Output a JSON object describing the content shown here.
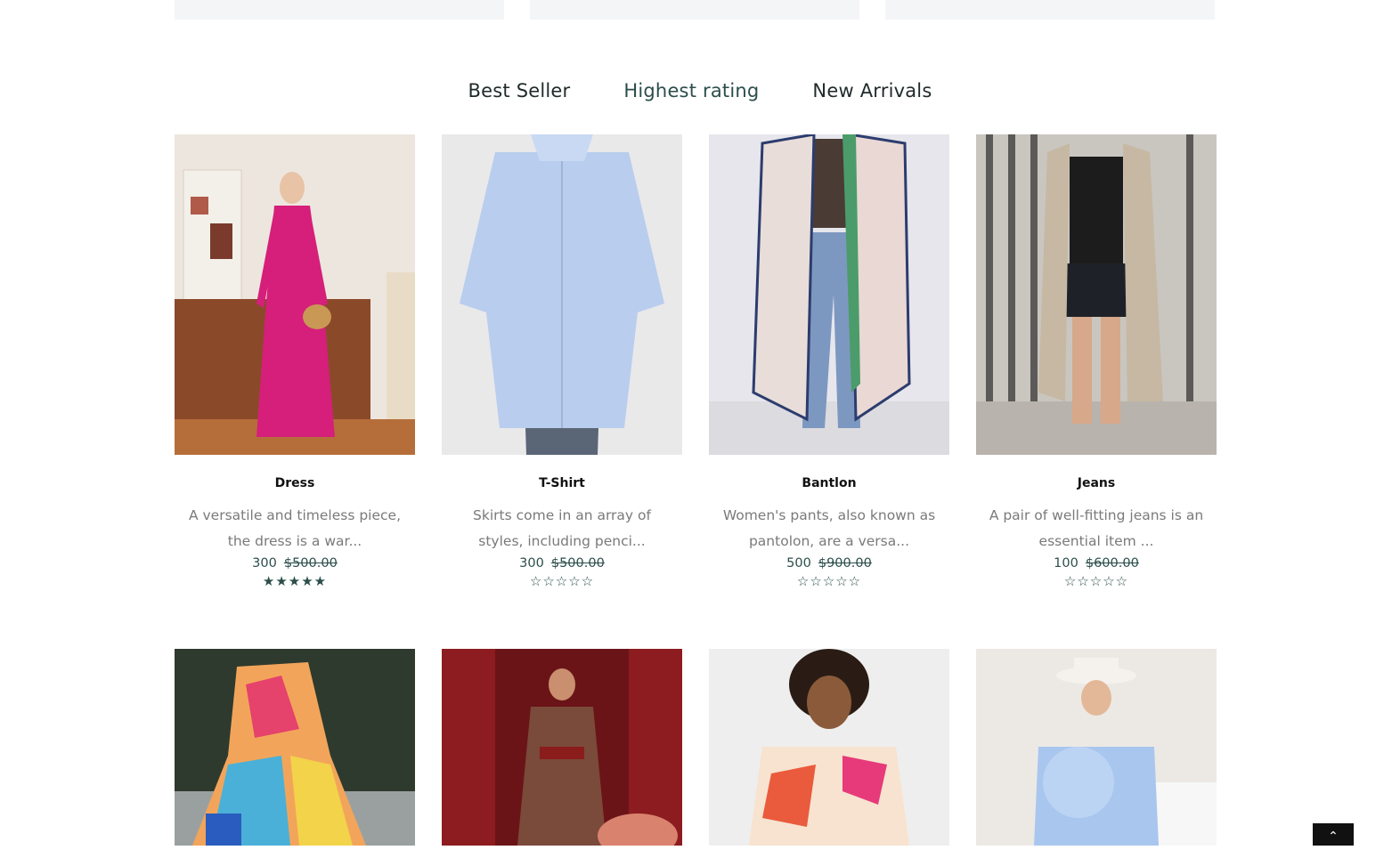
{
  "tabs": [
    {
      "label": "Best Seller",
      "active": false
    },
    {
      "label": "Highest rating",
      "active": true
    },
    {
      "label": "New Arrivals",
      "active": false
    }
  ],
  "products": [
    {
      "name": "Dress",
      "desc": "A versatile and timeless piece, the dress is a war...",
      "price": "300",
      "old_price": "$500.00",
      "stars": "★★★★★"
    },
    {
      "name": "T-Shirt",
      "desc": "Skirts come in an array of styles, including penci...",
      "price": "300",
      "old_price": "$500.00",
      "stars": "☆☆☆☆☆"
    },
    {
      "name": "Bantlon",
      "desc": "Women's pants, also known as pantolon, are a versa...",
      "price": "500",
      "old_price": "$900.00",
      "stars": "☆☆☆☆☆"
    },
    {
      "name": "Jeans",
      "desc": "A pair of well-fitting jeans is an essential item ...",
      "price": "100",
      "old_price": "$600.00",
      "stars": "☆☆☆☆☆"
    }
  ],
  "colors": {
    "accent": "#2b4e4a",
    "muted": "#7a7a7a"
  },
  "back_to_top_icon": "chevron-up-icon"
}
